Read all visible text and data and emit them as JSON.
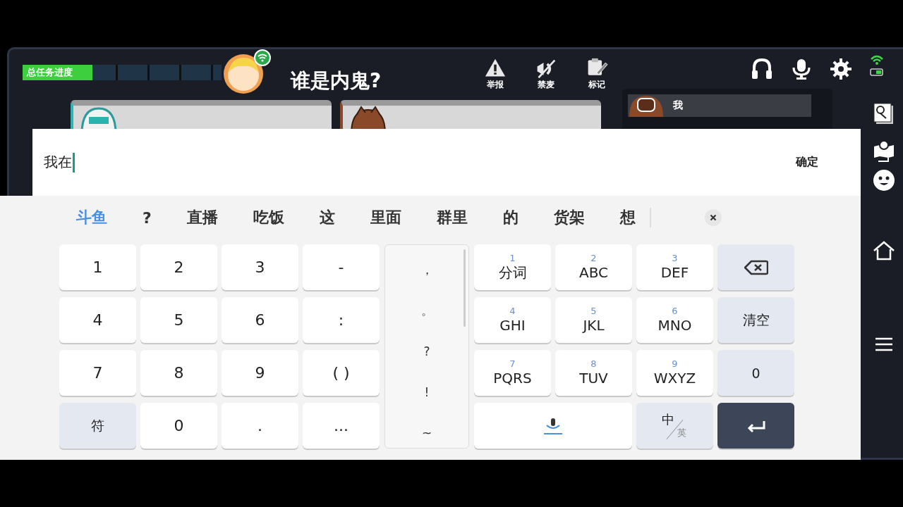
{
  "game": {
    "progress": {
      "label": "总任务进度",
      "level": 0.35
    },
    "title": "谁是内鬼?",
    "actions": [
      {
        "label": "举报",
        "kind": "report"
      },
      {
        "label": "禁麦",
        "kind": "mute"
      },
      {
        "label": "标记",
        "kind": "mark"
      }
    ],
    "players": [
      {
        "name": "我"
      }
    ]
  },
  "input": {
    "value": "我在",
    "confirm": "确定"
  },
  "candidates": [
    {
      "text": "斗鱼",
      "selected": true
    },
    {
      "text": "?",
      "selected": false
    },
    {
      "text": "直播",
      "selected": false
    },
    {
      "text": "吃饭",
      "selected": false
    },
    {
      "text": "这",
      "selected": false
    },
    {
      "text": "里面",
      "selected": false
    },
    {
      "text": "群里",
      "selected": false
    },
    {
      "text": "的",
      "selected": false
    },
    {
      "text": "货架",
      "selected": false
    },
    {
      "text": "想",
      "selected": false
    }
  ],
  "left_keys": [
    {
      "kind": "char",
      "label": "1"
    },
    {
      "kind": "char",
      "label": "2"
    },
    {
      "kind": "char",
      "label": "3"
    },
    {
      "kind": "char",
      "label": "-"
    },
    {
      "kind": "char",
      "label": "4"
    },
    {
      "kind": "char",
      "label": "5"
    },
    {
      "kind": "char",
      "label": "6"
    },
    {
      "kind": "char",
      "label": ":"
    },
    {
      "kind": "char",
      "label": "7"
    },
    {
      "kind": "char",
      "label": "8"
    },
    {
      "kind": "char",
      "label": "9"
    },
    {
      "kind": "char",
      "label": "( )"
    },
    {
      "kind": "func",
      "label": "符"
    },
    {
      "kind": "char",
      "label": "0"
    },
    {
      "kind": "char",
      "label": "."
    },
    {
      "kind": "char",
      "label": "..."
    }
  ],
  "punctuation": [
    "，",
    "。",
    "?",
    "!",
    "~"
  ],
  "right_keys": [
    {
      "kind": "t9",
      "digit": "1",
      "label": "分词"
    },
    {
      "kind": "t9",
      "digit": "2",
      "label": "ABC"
    },
    {
      "kind": "t9",
      "digit": "3",
      "label": "DEF"
    },
    {
      "kind": "backspace"
    },
    {
      "kind": "t9",
      "digit": "4",
      "label": "GHI"
    },
    {
      "kind": "t9",
      "digit": "5",
      "label": "JKL"
    },
    {
      "kind": "t9",
      "digit": "6",
      "label": "MNO"
    },
    {
      "kind": "func",
      "label": "清空"
    },
    {
      "kind": "t9",
      "digit": "7",
      "label": "PQRS"
    },
    {
      "kind": "t9",
      "digit": "8",
      "label": "TUV"
    },
    {
      "kind": "t9",
      "digit": "9",
      "label": "WXYZ"
    },
    {
      "kind": "func",
      "label": "0"
    },
    {
      "kind": "voice"
    },
    {
      "kind": "lang",
      "main": "中",
      "sub": "英"
    },
    {
      "kind": "enter"
    }
  ]
}
